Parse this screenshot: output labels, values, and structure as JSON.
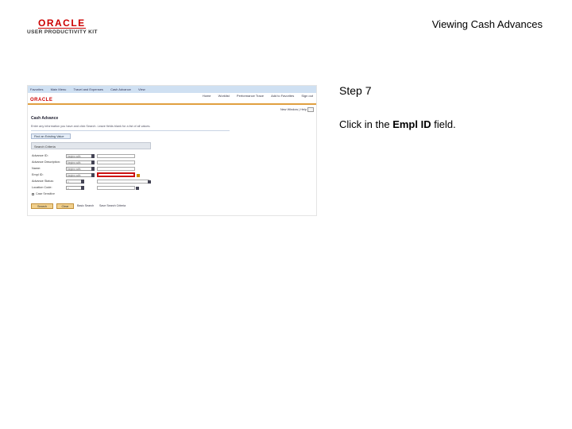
{
  "header": {
    "logo_brand": "ORACLE",
    "logo_sub": "USER PRODUCTIVITY KIT",
    "doc_title": "Viewing Cash Advances"
  },
  "screenshot": {
    "nav_top": [
      "Favorites",
      "Main Menu",
      "Travel and Expenses",
      "Cash Advance",
      "View"
    ],
    "nav_links": [
      "Home",
      "Worklist",
      "Performance Trace",
      "Add to Favorites",
      "Sign out"
    ],
    "brand": "ORACLE",
    "toolbar_right": "New Window | Help",
    "page_heading": "Cash Advance",
    "instructions": "Enter any information you have and click Search. Leave fields blank for a list of all values.",
    "tab_label": "Find an Existing Value",
    "search_criteria": "Search Criteria",
    "fields": [
      {
        "label": "Advance ID:",
        "operator": "begins with"
      },
      {
        "label": "Advance Description:",
        "operator": "begins with"
      },
      {
        "label": "Name:",
        "operator": "begins with"
      },
      {
        "label": "Empl ID:",
        "operator": "begins with"
      },
      {
        "label": "Advance Status:",
        "operator": "="
      },
      {
        "label": "Location Code:",
        "operator": "="
      }
    ],
    "case_sensitive": "Case Sensitive",
    "buttons": {
      "search": "Search",
      "clear": "Clear"
    },
    "basic_search": "Basic Search",
    "save_search": "Save Search Criteria"
  },
  "step": {
    "title": "Step 7",
    "instruction_prefix": "Click in the ",
    "instruction_bold": "Empl ID",
    "instruction_suffix": " field."
  },
  "colors": {
    "oracle_red": "#cc0000",
    "highlight": "#cc1111",
    "nav_blue": "#cfe0f2",
    "button_orange": "#f0cf8c"
  }
}
